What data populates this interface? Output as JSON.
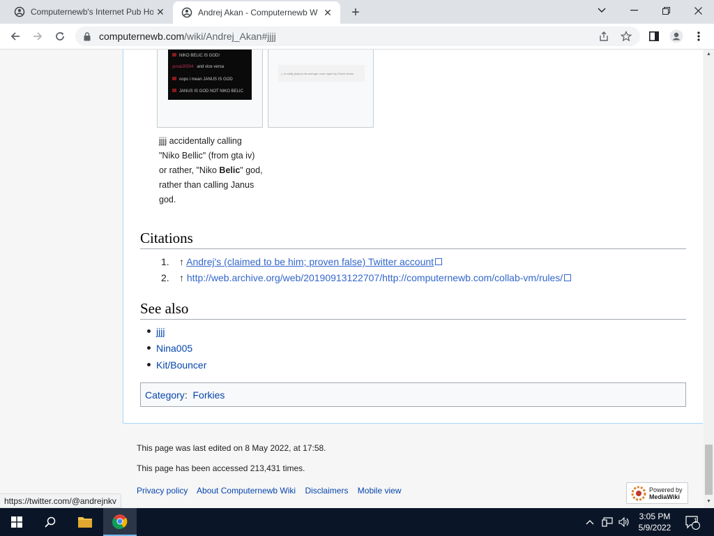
{
  "browser": {
    "tabs": [
      {
        "title": "Computernewb's Internet Pub Ho",
        "active": false
      },
      {
        "title": "Andrej Akan - Computernewb W",
        "active": true
      }
    ],
    "url_host": "computernewb.com",
    "url_path": "/wiki/Andrej_Akan#jjjj",
    "status_url": "https://twitter.com/@andrejnkv"
  },
  "gallery": {
    "dark_thumb_lines": [
      {
        "user": "",
        "text": "NIKO BELIC IS GOD!"
      },
      {
        "user": "yuvalJ0504",
        "text": "and vice versa"
      },
      {
        "user": "",
        "text": "oops i mean JANUS IS GOD"
      },
      {
        "user": "",
        "text": "JANUS IS GOD NOT NIKO BELIC"
      }
    ],
    "light_thumb_text": "i_ is oddly jealous his avenger once raped by Chuck Norris",
    "caption_parts": {
      "p1": "jjjj",
      "p2": " accidentally calling \"Niko Bellic\" (from gta iv) or rather, \"Niko ",
      "bold": "Belic",
      "p3": "\" god, rather than calling Janus god."
    }
  },
  "citations": {
    "heading": "Citations",
    "items": [
      {
        "num": "1.",
        "arrow": "↑",
        "text": "Andrej's (claimed to be him; proven false) Twitter account"
      },
      {
        "num": "2.",
        "arrow": "↑",
        "text": "http://web.archive.org/web/20190913122707/http://computernewb.com/collab-vm/rules/"
      }
    ]
  },
  "see_also": {
    "heading": "See also",
    "items": [
      "jjjj",
      "Nina005",
      "Kit/Bouncer"
    ]
  },
  "category": {
    "label": "Category",
    "value": "Forkies"
  },
  "footer": {
    "last_edited": "This page was last edited on 8 May 2022, at 17:58.",
    "accessed": "This page has been accessed 213,431 times.",
    "links": [
      "Privacy policy",
      "About Computernewb Wiki",
      "Disclaimers",
      "Mobile view"
    ],
    "powered_line1": "Powered by",
    "powered_line2": "MediaWiki"
  },
  "taskbar": {
    "time": "3:05 PM",
    "date": "5/9/2022",
    "notification_count": "1"
  },
  "colors": {
    "link": "#3366cc",
    "link_blue": "#0645ad",
    "taskbar": "#0a1628"
  }
}
